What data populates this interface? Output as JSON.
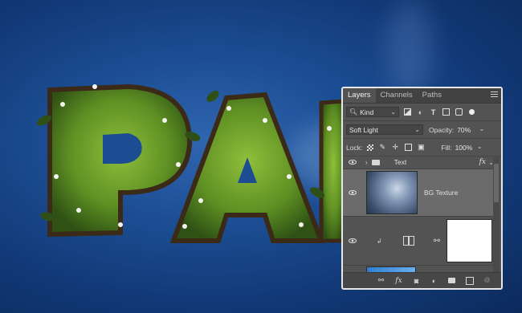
{
  "panel": {
    "tabs": [
      {
        "label": "Layers",
        "active": true
      },
      {
        "label": "Channels",
        "active": false
      },
      {
        "label": "Paths",
        "active": false
      }
    ],
    "filter_kind": "Kind",
    "blend_mode": "Soft Light",
    "opacity_label": "Opacity:",
    "opacity_value": "70%",
    "lock_label": "Lock:",
    "fill_label": "Fill:",
    "fill_value": "100%",
    "layers": [
      {
        "name": "Text",
        "type": "group",
        "fx_label": "fx"
      },
      {
        "name": "BG Texture",
        "type": "pixel",
        "selected": true
      },
      {
        "name": "",
        "type": "adjustment"
      },
      {
        "name": "",
        "type": "gradient"
      }
    ],
    "bottom_fx_label": "fx"
  },
  "colors": {
    "panel_bg": "#535353",
    "selected_row": "#6b6b6b",
    "background_blue": "#1c4d93",
    "foliage_green": "#5e8f23"
  }
}
